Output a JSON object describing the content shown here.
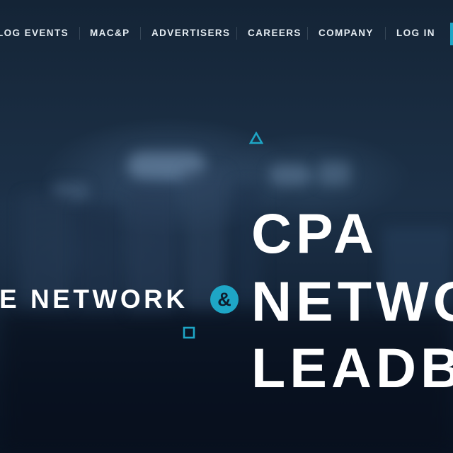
{
  "nav": {
    "items": [
      {
        "label": "LOG EVENTS"
      },
      {
        "label": "MAC&P"
      },
      {
        "label": "ADVERTISERS"
      },
      {
        "label": "CAREERS"
      },
      {
        "label": "COMPANY"
      },
      {
        "label": "LOG IN"
      }
    ]
  },
  "hero": {
    "tagline": "E NETWORK",
    "ampersand": "&",
    "headline": [
      "CPA",
      "NETWO",
      "LEADB"
    ]
  },
  "colors": {
    "accent": "#1ea6c6",
    "background": "#142436",
    "text": "#ffffff"
  },
  "icons": [
    "triangle-outline-icon",
    "square-outline-icon"
  ]
}
